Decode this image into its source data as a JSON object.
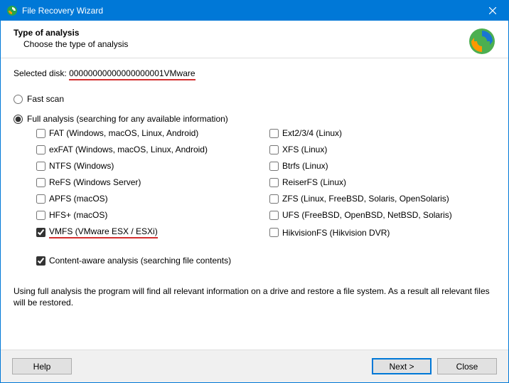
{
  "window": {
    "title": "File Recovery Wizard"
  },
  "header": {
    "heading": "Type of analysis",
    "subtitle": "Choose the type of analysis"
  },
  "selected_disk": {
    "label": "Selected disk:",
    "value": "00000000000000000001VMware"
  },
  "analysis": {
    "fast_label": "Fast scan",
    "full_label": "Full analysis (searching for any available information)",
    "selected": "full"
  },
  "filesystems": {
    "left": [
      {
        "label": "FAT (Windows, macOS, Linux, Android)",
        "checked": false,
        "highlight": false
      },
      {
        "label": "exFAT (Windows, macOS, Linux, Android)",
        "checked": false,
        "highlight": false
      },
      {
        "label": "NTFS (Windows)",
        "checked": false,
        "highlight": false
      },
      {
        "label": "ReFS (Windows Server)",
        "checked": false,
        "highlight": false
      },
      {
        "label": "APFS (macOS)",
        "checked": false,
        "highlight": false
      },
      {
        "label": "HFS+ (macOS)",
        "checked": false,
        "highlight": false
      },
      {
        "label": "VMFS (VMware ESX / ESXi)",
        "checked": true,
        "highlight": true
      }
    ],
    "right": [
      {
        "label": "Ext2/3/4 (Linux)",
        "checked": false,
        "highlight": false
      },
      {
        "label": "XFS (Linux)",
        "checked": false,
        "highlight": false
      },
      {
        "label": "Btrfs (Linux)",
        "checked": false,
        "highlight": false
      },
      {
        "label": "ReiserFS (Linux)",
        "checked": false,
        "highlight": false
      },
      {
        "label": "ZFS (Linux, FreeBSD, Solaris, OpenSolaris)",
        "checked": false,
        "highlight": false
      },
      {
        "label": "UFS (FreeBSD, OpenBSD, NetBSD, Solaris)",
        "checked": false,
        "highlight": false
      },
      {
        "label": "HikvisionFS (Hikvision DVR)",
        "checked": false,
        "highlight": false
      }
    ]
  },
  "content_aware": {
    "label": "Content-aware analysis (searching file contents)",
    "checked": true
  },
  "description": "Using full analysis the program will find all relevant information on a drive and restore a file system. As a result all relevant files will be restored.",
  "buttons": {
    "help": "Help",
    "next": "Next >",
    "close": "Close"
  }
}
